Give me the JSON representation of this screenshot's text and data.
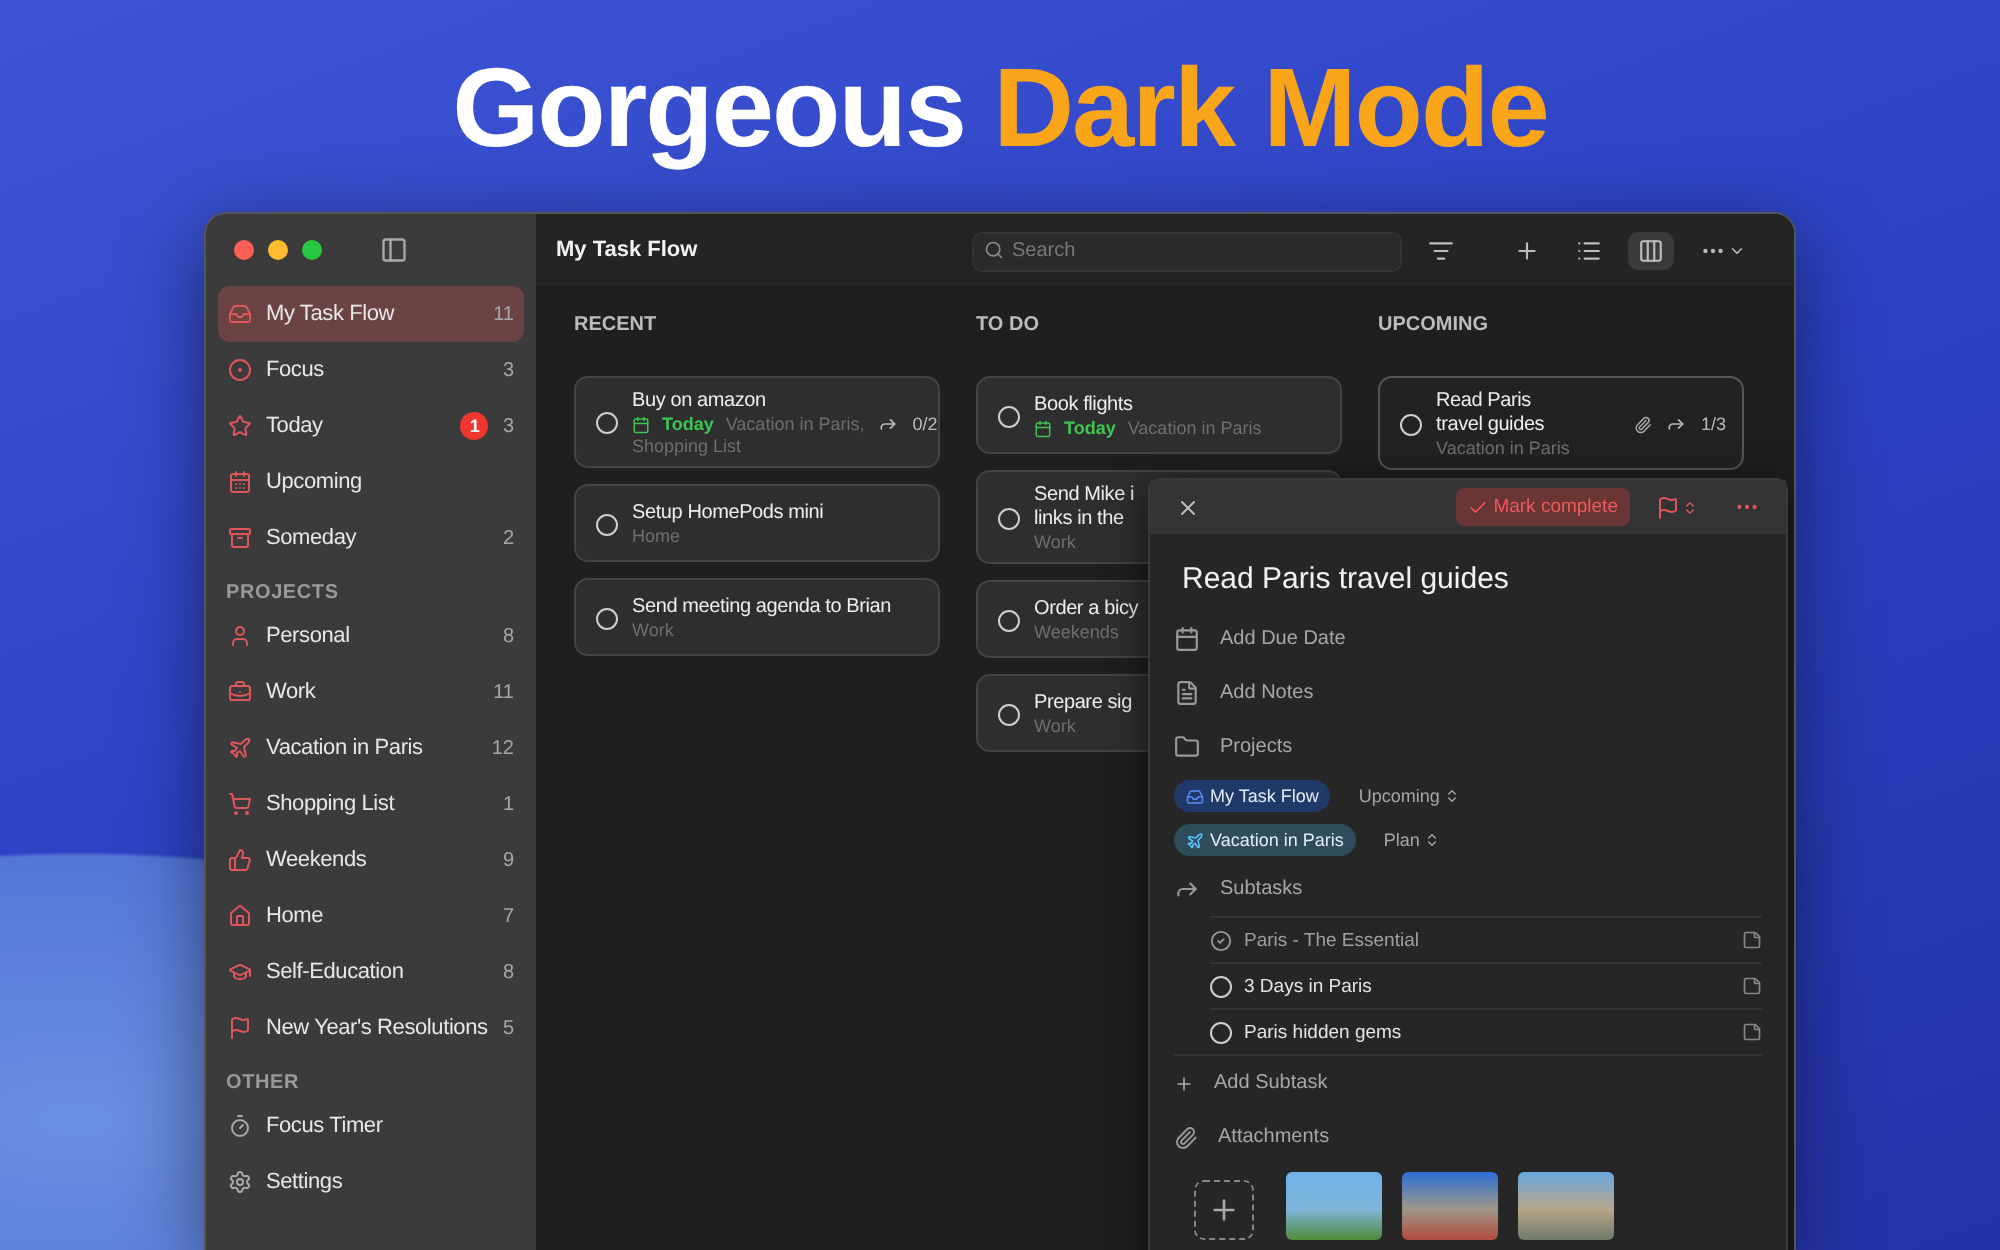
{
  "headline": [
    {
      "text": "Gorgeous",
      "accent": false
    },
    {
      "text": "Dark Mode",
      "accent": true
    }
  ],
  "sidebar": {
    "sections": [
      {
        "items": [
          {
            "label": "My Task Flow",
            "count": "11",
            "selected": true
          },
          {
            "label": "Focus",
            "count": "3",
            "selected": false
          },
          {
            "label": "Today",
            "count": "3",
            "badge": "1",
            "selected": false
          },
          {
            "label": "Upcoming",
            "selected": false
          },
          {
            "label": "Someday",
            "count": "2",
            "selected": false
          }
        ]
      },
      {
        "heading": "PROJECTS",
        "items": [
          {
            "label": "Personal",
            "count": "8",
            "selected": false
          },
          {
            "label": "Work",
            "count": "11",
            "selected": false
          },
          {
            "label": "Vacation in Paris",
            "count": "12",
            "selected": false
          },
          {
            "label": "Shopping List",
            "count": "1",
            "selected": false
          },
          {
            "label": "Weekends",
            "count": "9",
            "selected": false
          },
          {
            "label": "Home",
            "count": "7",
            "selected": false
          },
          {
            "label": "Self-Education",
            "count": "8",
            "selected": false
          },
          {
            "label": "New Year's Resolutions",
            "count": "5",
            "selected": false
          }
        ]
      },
      {
        "heading": "OTHER",
        "items": [
          {
            "label": "Focus Timer",
            "selected": false
          },
          {
            "label": "Settings",
            "selected": false
          }
        ]
      }
    ]
  },
  "toolbar": {
    "title": "My Task Flow",
    "search": {
      "placeholder": "Search"
    }
  },
  "columns": [
    {
      "heading": "RECENT",
      "cards": [
        {
          "title": [
            "Buy on amazon"
          ],
          "date": "Today",
          "project": "Vacation in Paris,",
          "project_2": "Shopping List",
          "subtasks": "0/2",
          "selected": false
        },
        {
          "title": [
            "Setup HomePods mini"
          ],
          "project": "Home",
          "selected": false
        },
        {
          "title": [
            "Send meeting agenda to Brian"
          ],
          "project": "Work",
          "selected": false
        }
      ]
    },
    {
      "heading": "TO DO",
      "cards": [
        {
          "title": [
            "Book flights"
          ],
          "date": "Today",
          "project": "Vacation in Paris",
          "selected": false
        },
        {
          "title": [
            "Send Mike i",
            "links in the"
          ],
          "project": "Work",
          "selected": false
        },
        {
          "title": [
            "Order a bicy"
          ],
          "project": "Weekends",
          "selected": false
        },
        {
          "title": [
            "Prepare sig"
          ],
          "project": "Work",
          "selected": false
        }
      ]
    },
    {
      "heading": "UPCOMING",
      "cards": [
        {
          "title": [
            "Read Paris",
            "travel guides"
          ],
          "project": "Vacation in Paris",
          "attachment": true,
          "subtasks": "1/3",
          "selected": true
        }
      ]
    }
  ],
  "detail": {
    "mark_complete": "Mark complete",
    "title": "Read Paris travel guides",
    "fields": [
      "Add Due Date",
      "Add Notes",
      "Projects"
    ],
    "projects": [
      {
        "label": "My Task Flow",
        "section": "Upcoming"
      },
      {
        "label": "Vacation in Paris",
        "section": "Plan"
      }
    ],
    "subtasks_label": "Subtasks",
    "subtasks": [
      {
        "label": "Paris - The Essential",
        "checked": true
      },
      {
        "label": "3 Days in Paris",
        "checked": false
      },
      {
        "label": "Paris hidden gems",
        "checked": false
      }
    ],
    "add_subtask": "Add Subtask",
    "attachments_label": "Attachments"
  }
}
